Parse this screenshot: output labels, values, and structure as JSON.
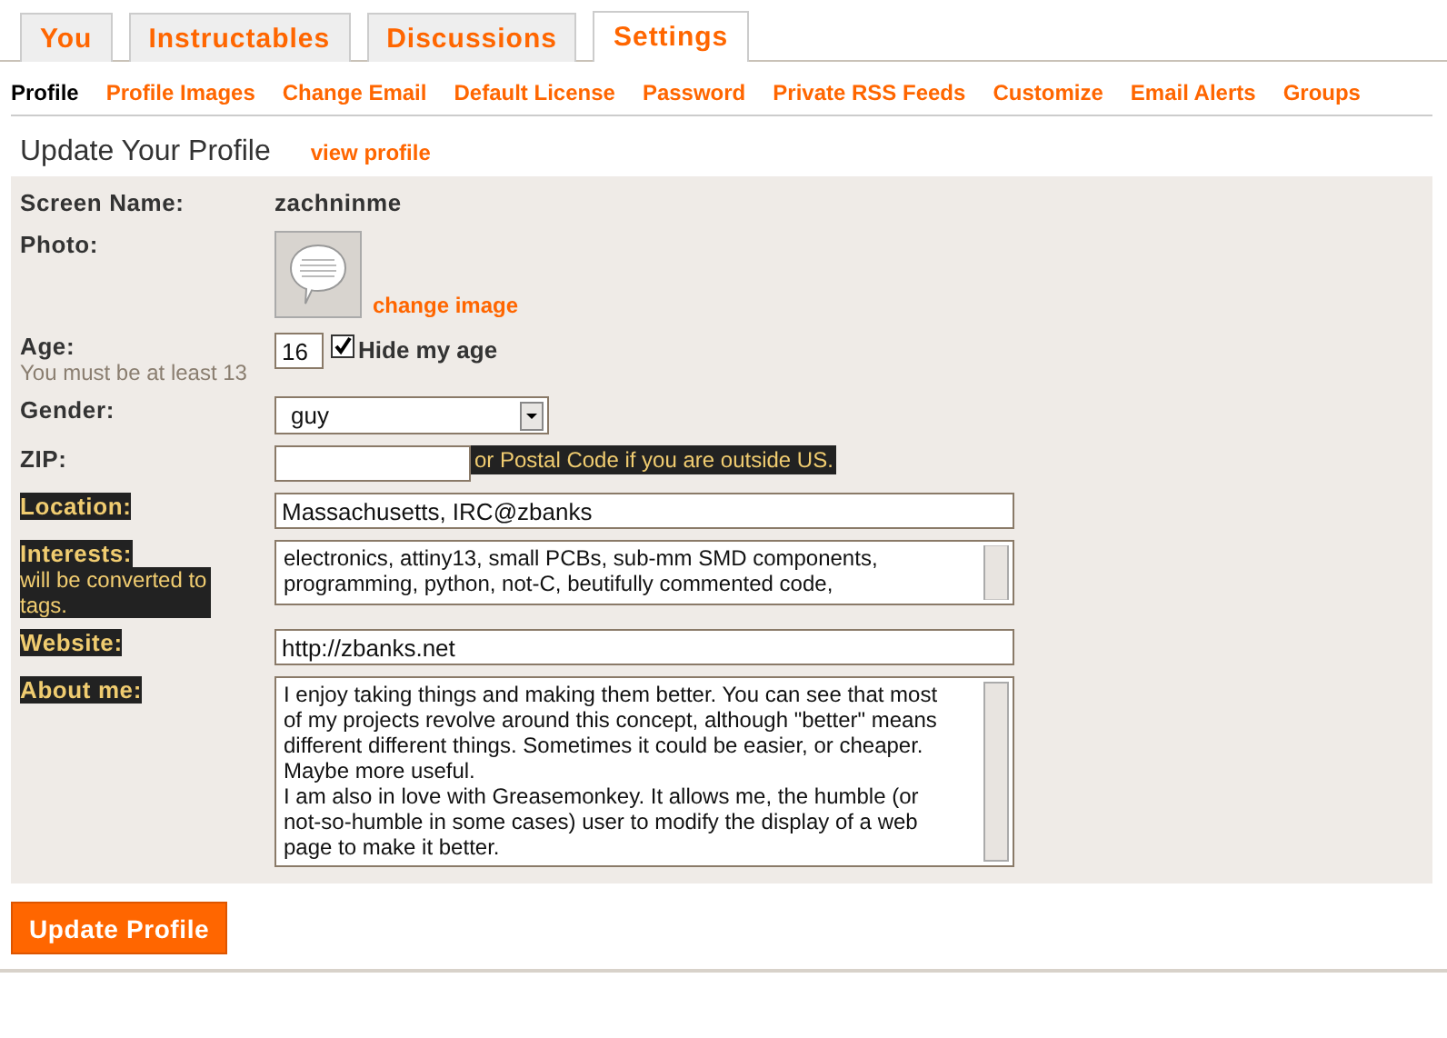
{
  "tabs": [
    {
      "label": "You",
      "selected": false
    },
    {
      "label": "Instructables",
      "selected": false
    },
    {
      "label": "Discussions",
      "selected": false
    },
    {
      "label": "Settings",
      "selected": true
    }
  ],
  "subnav": [
    {
      "label": "Profile",
      "selected": true
    },
    {
      "label": "Profile Images",
      "selected": false
    },
    {
      "label": "Change Email",
      "selected": false
    },
    {
      "label": "Default License",
      "selected": false
    },
    {
      "label": "Password",
      "selected": false
    },
    {
      "label": "Private RSS Feeds",
      "selected": false
    },
    {
      "label": "Customize",
      "selected": false
    },
    {
      "label": "Email Alerts",
      "selected": false
    },
    {
      "label": "Groups",
      "selected": false
    }
  ],
  "heading": "Update Your Profile",
  "view_link": "view profile",
  "rows": [
    {
      "kind": "text",
      "label": "Screen Name:",
      "highlighted": false,
      "value": "zachninme"
    },
    {
      "kind": "photo",
      "label": "Photo:",
      "highlighted": false,
      "link": "change image"
    },
    {
      "kind": "age",
      "label": "Age:",
      "hint": "You must be at least 13",
      "highlighted": false,
      "value": "16",
      "checkbox_label": "Hide my age",
      "checked": true
    },
    {
      "kind": "select",
      "label": "Gender:",
      "highlighted": false,
      "value": "guy"
    },
    {
      "kind": "zip",
      "label": "ZIP:",
      "highlighted": false,
      "value": "",
      "note": "or Postal Code if you are outside US.",
      "note_highlighted": true
    },
    {
      "kind": "input",
      "label": "Location:",
      "highlighted": true,
      "value": "Massachusetts, IRC@zbanks"
    },
    {
      "kind": "textarea",
      "label": "Interests:",
      "hint": "will be converted to tags.",
      "highlighted": true,
      "value": "electronics, attiny13, small PCBs, sub-mm SMD components,\nprogramming, python, not-C, beutifully commented code,"
    },
    {
      "kind": "input",
      "label": "Website:",
      "highlighted": true,
      "value": "http://zbanks.net"
    },
    {
      "kind": "textarea",
      "label": "About me:",
      "highlighted": true,
      "value": "I enjoy taking things and making them better. You can see that most\nof my projects revolve around this concept, although \"better\" means\ndifferent different things. Sometimes it could be easier, or cheaper.\nMaybe more useful.\nI am also in love with Greasemonkey. It allows me, the humble (or\nnot-so-humble in some cases) user to modify the display of a web\npage to make it better."
    }
  ],
  "submit": "Update Profile"
}
